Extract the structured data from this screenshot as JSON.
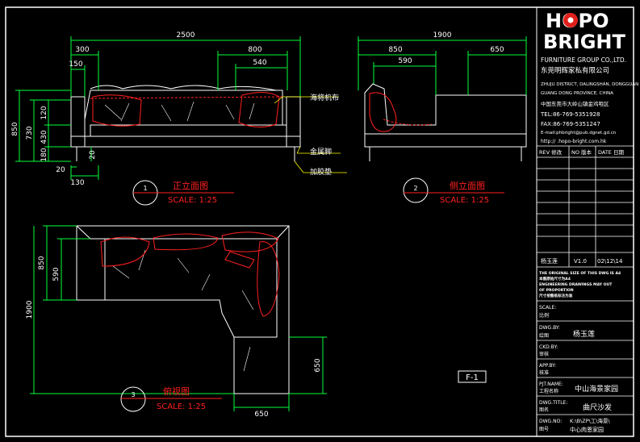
{
  "colors": {
    "background": "#000000",
    "border": "#ffffff",
    "dimension": "#00ff3c",
    "dimension_text": "#ffffff",
    "annotation": "#ff2020",
    "leader": "#ffff00",
    "logo_red": "#e0201b"
  },
  "front_view": {
    "dims": {
      "overall_width": "2500",
      "arm_width": "300",
      "arm_inner": "150",
      "seat_back": "800",
      "cushion": "540",
      "total_height": "850",
      "back_height": "730",
      "arm_top": "120",
      "seat_height": "430",
      "leg_height": "180",
      "leg_width": "130",
      "leg_offset": "20",
      "base_rail": "20"
    },
    "callouts": [
      "海将机布",
      "金属脚",
      "加胶垫"
    ],
    "number": "1",
    "title": "正立面图",
    "scale": "SCALE: 1:25"
  },
  "side_view": {
    "dims": {
      "overall_depth": "1900",
      "seat_depth": "850",
      "cushion_depth": "590",
      "chaise_end": "650"
    },
    "number": "2",
    "title": "侧立面图",
    "scale": "SCALE: 1:25"
  },
  "plan_view": {
    "dims": {
      "depth": "850",
      "back_depth": "590",
      "overall_length": "1900",
      "chaise_leg": "650",
      "chaise_width": "650"
    },
    "number": "3",
    "title": "俯视图",
    "scale": "SCALE: 1:25"
  },
  "sheet_label": "F-1",
  "title_block": {
    "logo_top": "HOPO",
    "logo_bottom": "BRIGHT",
    "company_en": "FURNITURE GROUP CO.,LTD.",
    "company_cn": "东莞明辉家私有限公司",
    "address_en_1": "ZHUJU DISTRICT, DALINGSHAN, DONGGUAN",
    "address_en_2": "GUANG DONG PROVINCE, CHINA",
    "address_cn": "中国东莞市大岭山镇金鸡咀区",
    "tel": "TEL:86-769-5351928",
    "fax": "FAX:86-769-5351247",
    "email": "E-mail:phbright@pub.dgnet.gd.cn",
    "website": "http://    .hopo-bright.com.hk",
    "rev_headers": [
      "REV 修改",
      "NO 版本",
      "DATE 日期"
    ],
    "signoff": {
      "name": "杨玉莲",
      "version": "V1.0",
      "date": "02\\12\\14"
    },
    "notice_1": "THE ORIGINAL SIZE OF THIS DWG IS A4",
    "notice_2": "本图原始尺寸为A4",
    "notice_3": "ENGINEERING DRAWINGS MAY OUT",
    "notice_4": "OF PROPORTION",
    "notice_5": "尺寸按图纸标注为准",
    "scale_label": "SCALE:",
    "scale_cn": "比例",
    "drawn_label": "DWG.BY:",
    "drawn_cn": "绘图",
    "drawn_value": "杨玉莲",
    "checked_label": "CKD.BY:",
    "checked_cn": "审核",
    "approved_label": "APP.BY:",
    "approved_cn": "核准",
    "project_label": "PJT.NAME:",
    "project_cn": "工程名称",
    "project_value": "中山海景家园",
    "dwg_title_label": "DWG.TITLE:",
    "dwg_title_cn": "图名",
    "dwg_title_value": "曲尺沙发",
    "dwg_no_label": "DWG.NO:",
    "dwg_no_cn": "图号",
    "dwg_no_value": "K:\\B\\ZP\\工\\海景\\",
    "dwg_no_value_2": "中心肉恩家园"
  }
}
